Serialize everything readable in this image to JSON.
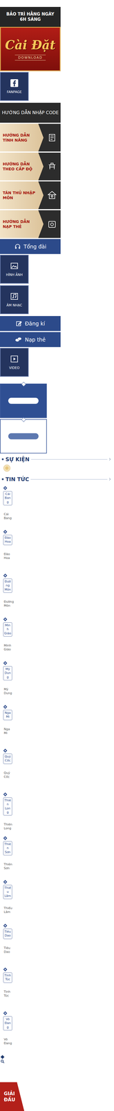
{
  "maintenance": "BẢO TRÌ HẰNG NGÀY 6H SÁNG",
  "download": {
    "logo": "Cài Đặt",
    "label": "DOWNLOAD"
  },
  "fanpage": "FANPAGE",
  "code_guide": "HƯỚNG DẪN NHẬP CODE",
  "guides": [
    "HƯỚNG DẪN TÍNH NĂNG",
    "HƯỚNG DẪN THEO CẤP ĐỘ",
    "TÂN THỦ NHẬP MÔN",
    "HƯỚNG DẪN NẠP THẺ"
  ],
  "hotline": "Tổng đài",
  "gallery": "HÌNH ẢNH",
  "music": "ÂM NHẠC",
  "register": "Đăng kí",
  "topup": "Nạp thẻ",
  "video": "VIDEO",
  "events_heading": "SỰ KIỆN",
  "news_heading": "TIN TỨC",
  "sects": [
    {
      "box": "Cái Bang",
      "caption": "Cái Bang"
    },
    {
      "box": "Đào Hoa",
      "caption": "Đào Hoa"
    },
    {
      "box": "Đường Môn",
      "caption": "Đường Môn"
    },
    {
      "box": "Minh Giáo",
      "caption": "Minh Giáo"
    },
    {
      "box": "Mỹ Dung",
      "caption": "Mỹ Dung"
    },
    {
      "box": "Nga Mi",
      "caption": "Nga Mi"
    },
    {
      "box": "Quỷ Cốc",
      "caption": "Quỷ Cốc"
    },
    {
      "box": "Thiên Long",
      "caption": "Thiên Long"
    },
    {
      "box": "Thiên Sơn",
      "caption": "Thiên Sơn"
    },
    {
      "box": "Thiếu Lâm",
      "caption": "Thiếu Lâm"
    },
    {
      "box": "Tiêu Dao",
      "caption": "Tiêu Dao"
    },
    {
      "box": "Tinh Túc",
      "caption": "Tinh Túc"
    },
    {
      "box": "Võ Đang",
      "caption": "Võ Đang"
    }
  ],
  "tournament": "GIẢI ĐẤU"
}
